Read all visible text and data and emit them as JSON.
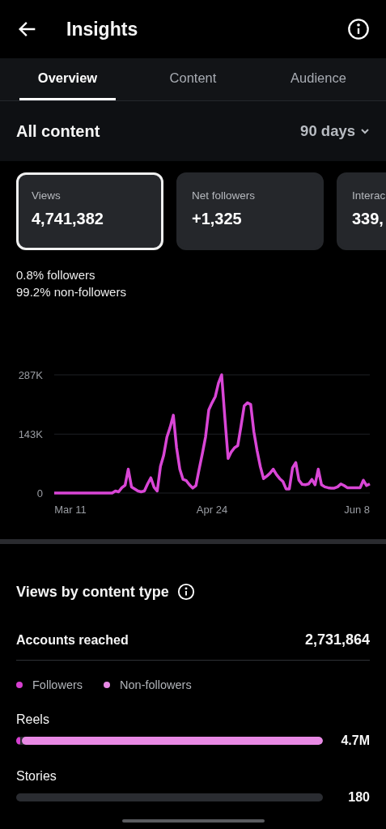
{
  "header": {
    "title": "Insights"
  },
  "tabs": [
    {
      "label": "Overview",
      "selected": true
    },
    {
      "label": "Content",
      "selected": false
    },
    {
      "label": "Audience",
      "selected": false
    }
  ],
  "section": {
    "title": "All content",
    "range": "90 days"
  },
  "cards": [
    {
      "label": "Views",
      "value": "4,741,382",
      "selected": true
    },
    {
      "label": "Net followers",
      "value": "+1,325",
      "selected": false
    },
    {
      "label": "Interac",
      "value": "339,",
      "selected": false
    }
  ],
  "breakdown": [
    "0.8% followers",
    "99.2% non-followers"
  ],
  "chart_data": {
    "type": "line",
    "categories": [
      null,
      null,
      null,
      null,
      null,
      "Mar 11",
      null,
      null,
      null,
      null,
      null,
      null,
      null,
      null,
      null,
      null,
      null,
      null,
      null,
      null,
      null,
      null,
      null,
      null,
      null,
      null,
      null,
      null,
      null,
      null,
      null,
      null,
      null,
      null,
      null,
      null,
      null,
      null,
      null,
      null,
      null,
      null,
      null,
      null,
      null,
      null,
      null,
      null,
      null,
      "Apr 24",
      null,
      null,
      null,
      null,
      null,
      null,
      null,
      null,
      null,
      null,
      null,
      null,
      null,
      null,
      null,
      null,
      null,
      null,
      null,
      null,
      null,
      null,
      null,
      null,
      null,
      null,
      null,
      null,
      null,
      null,
      null,
      null,
      null,
      null,
      null,
      null,
      null,
      null,
      null,
      null,
      null,
      null,
      null,
      null,
      "Jun 8",
      null,
      null,
      null,
      null
    ],
    "series": [
      {
        "color": "#d946d6",
        "values": [
          0,
          0,
          0,
          0,
          0,
          0,
          0,
          0,
          0,
          0,
          0,
          0,
          0,
          0,
          0,
          0,
          0,
          0,
          0,
          5,
          3,
          13,
          19,
          58,
          15,
          10,
          5,
          3,
          5,
          22,
          37,
          14,
          5,
          65,
          92,
          136,
          160,
          189,
          110,
          58,
          33,
          30,
          20,
          12,
          18,
          58,
          96,
          136,
          202,
          219,
          234,
          267,
          287,
          182,
          84,
          100,
          110,
          115,
          162,
          212,
          219,
          215,
          149,
          103,
          64,
          35,
          41,
          48,
          58,
          45,
          35,
          28,
          10,
          10,
          61,
          74,
          31,
          21,
          20,
          22,
          33,
          20,
          58,
          20,
          15,
          13,
          12,
          12,
          15,
          22,
          18,
          13,
          13,
          13,
          13,
          13,
          31,
          18,
          22
        ]
      }
    ],
    "ylim": [
      0,
      287
    ],
    "yticks": [
      {
        "value": 0,
        "label": "0"
      },
      {
        "value": 143,
        "label": "143K"
      },
      {
        "value": 287,
        "label": "287K"
      }
    ]
  },
  "content_type": {
    "title": "Views by content type",
    "reach_label": "Accounts reached",
    "reach_value": "2,731,864",
    "legend": [
      {
        "label": "Followers",
        "color": "#d63fd0"
      },
      {
        "label": "Non-followers",
        "color": "#e889e4"
      }
    ],
    "rows": [
      {
        "label": "Reels",
        "value": "4.7M",
        "segments": [
          {
            "level": 0.012
          },
          {
            "level": 0.988
          }
        ]
      },
      {
        "label": "Stories",
        "value": "180"
      }
    ]
  }
}
